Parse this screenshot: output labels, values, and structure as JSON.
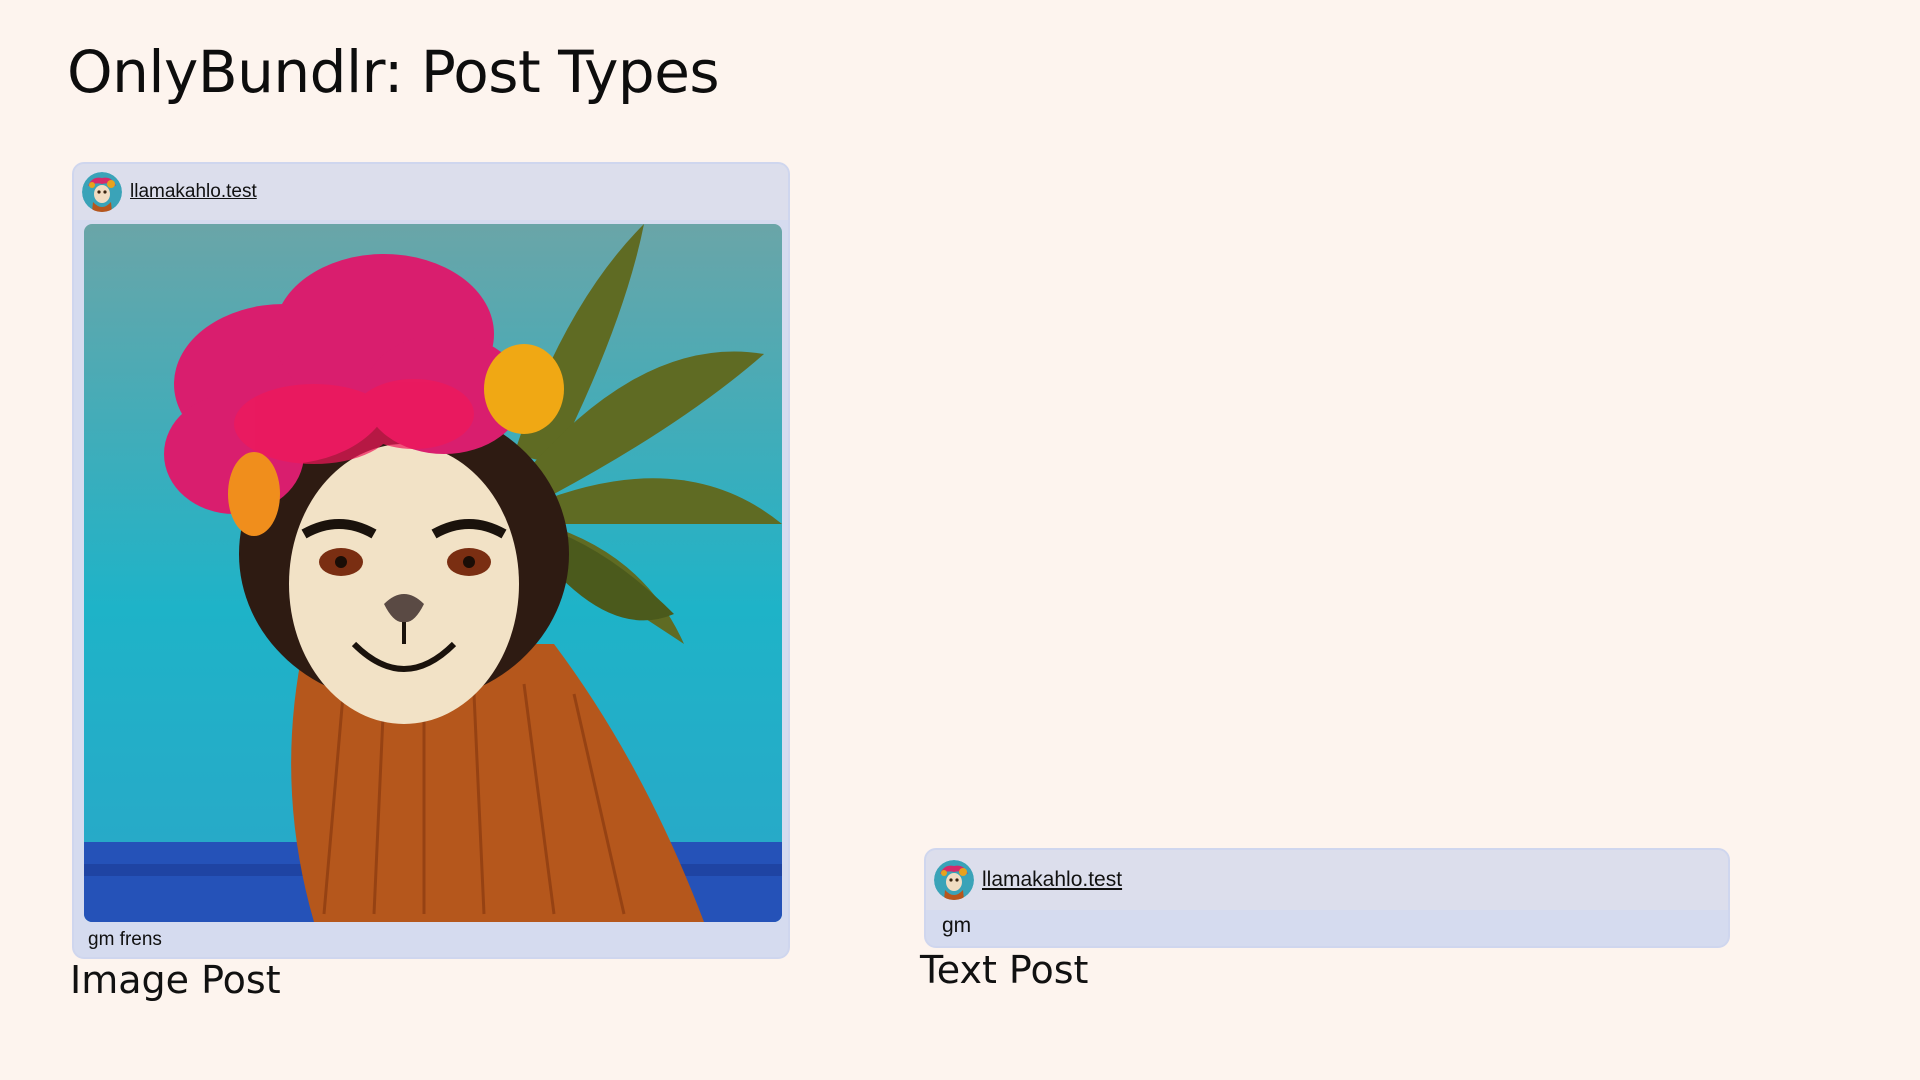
{
  "page": {
    "title": "OnlyBundlr: Post Types"
  },
  "image_post": {
    "username": "llamakahlo.test",
    "caption": "gm frens",
    "image_icon": "llama-painting-image",
    "label": "Image Post"
  },
  "text_post": {
    "username": "llamakahlo.test",
    "caption": "gm",
    "label": "Text Post"
  },
  "colors": {
    "background": "#fdf4ee",
    "card": "#d5dbef",
    "card_header": "#dcdeec"
  }
}
